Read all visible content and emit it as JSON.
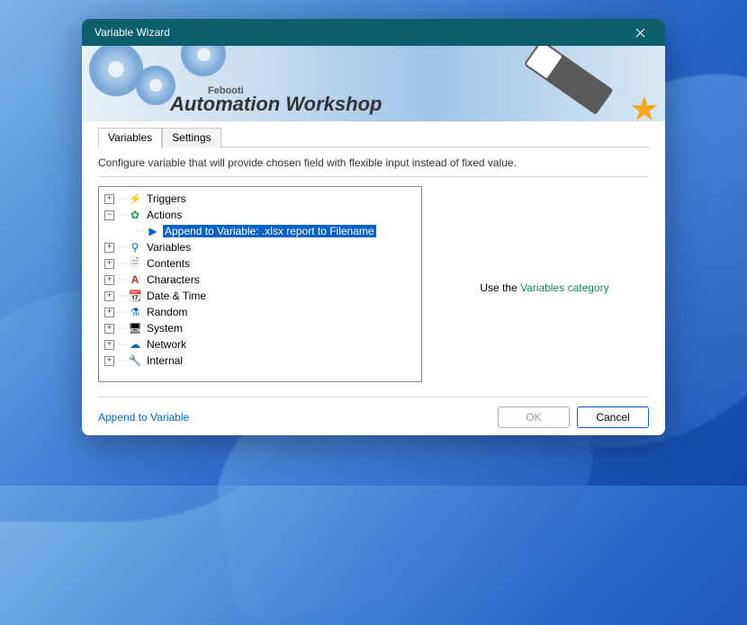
{
  "window": {
    "title": "Variable Wizard"
  },
  "banner": {
    "brand": "Febooti",
    "title": "Automation Workshop"
  },
  "tabs": {
    "variables": "Variables",
    "settings": "Settings",
    "active": "variables"
  },
  "description": "Configure variable that will provide chosen field with flexible input instead of fixed value.",
  "tree": {
    "triggers": "Triggers",
    "actions": "Actions",
    "action_child": "Append to Variable: .xlsx report to Filename",
    "variables": "Variables",
    "contents": "Contents",
    "characters": "Characters",
    "datetime": "Date & Time",
    "random": "Random",
    "system": "System",
    "network": "Network",
    "internal": "Internal"
  },
  "side": {
    "prefix": "Use the ",
    "link": "Variables category"
  },
  "footer": {
    "link": "Append to Variable",
    "ok": "OK",
    "cancel": "Cancel"
  }
}
